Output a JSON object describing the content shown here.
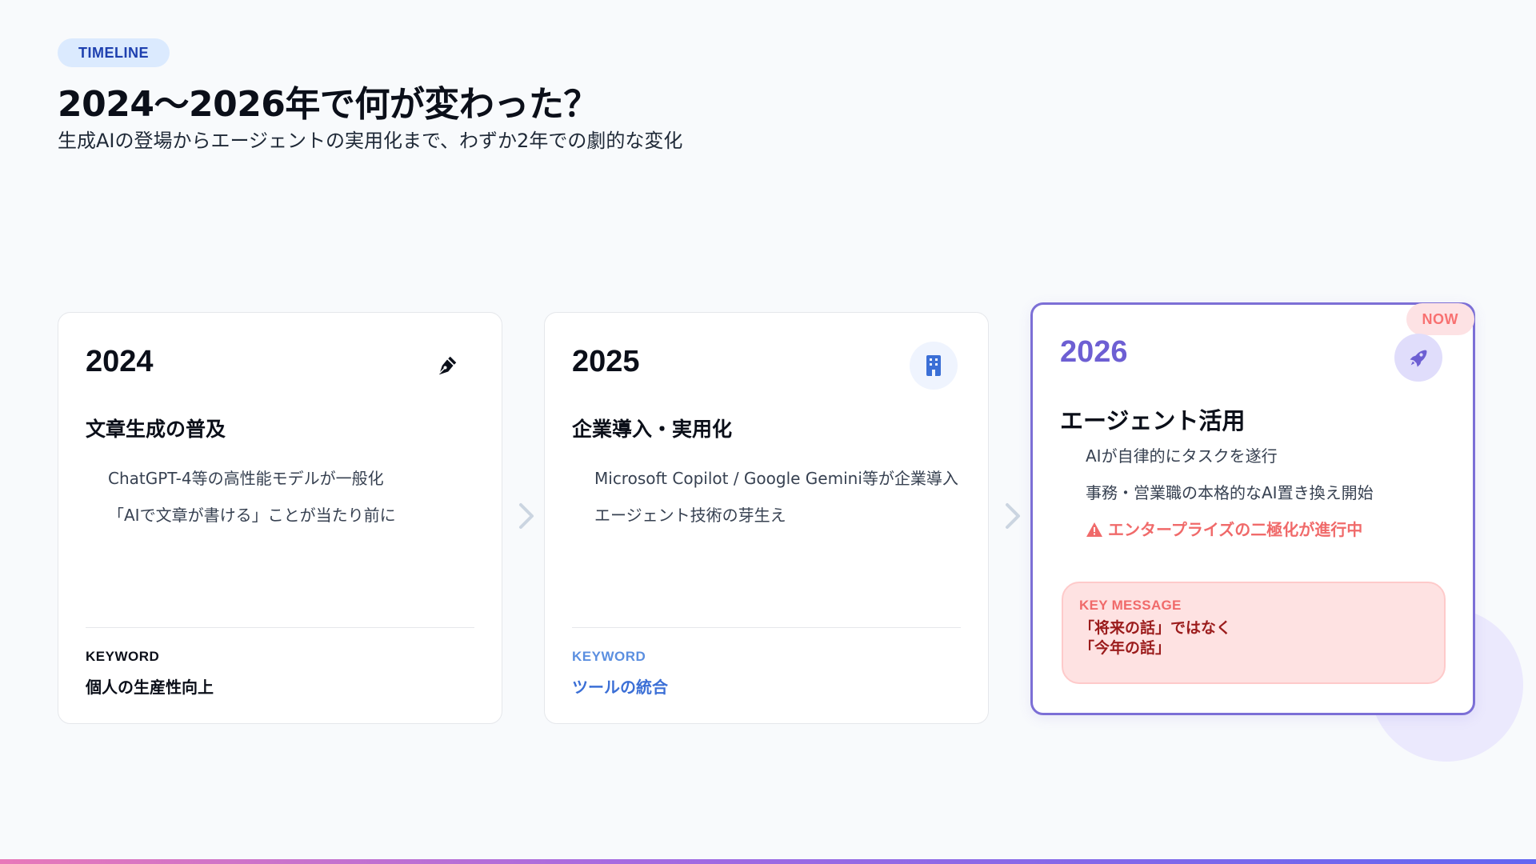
{
  "header": {
    "tag": "TIMELINE",
    "title": "2024〜2026年で何が変わった？",
    "subtitle": "生成AIの登場からエージェントの実用化まで、わずか2年での劇的な変化"
  },
  "cards": [
    {
      "year": "2024",
      "icon": "pen-nib-icon",
      "heading": "文章生成の普及",
      "bullets": [
        "ChatGPT-4等の高性能モデルが一般化",
        "「AIで文章が書ける」ことが当たり前に"
      ],
      "keyword_label": "KEYWORD",
      "keyword": "個人の生産性向上"
    },
    {
      "year": "2025",
      "icon": "building-icon",
      "heading": "企業導入・実用化",
      "bullets": [
        "Microsoft Copilot / Google Gemini等が企業導入",
        "エージェント技術の芽生え"
      ],
      "keyword_label": "KEYWORD",
      "keyword": "ツールの統合"
    },
    {
      "year": "2026",
      "icon": "rocket-icon",
      "badge": "NOW",
      "heading": "エージェント活用",
      "bullets": [
        "AIが自律的にタスクを遂行",
        "事務・営業職の本格的なAI置き換え開始"
      ],
      "alert": "エンタープライズの二極化が進行中",
      "key_label": "KEY MESSAGE",
      "key_message": "「将来の話」ではなく\n「今年の話」"
    }
  ],
  "colors": {
    "accent_purple": "#6d5fd3",
    "accent_blue": "#3b6fd6",
    "alert_red": "#f06a6a",
    "key_text": "#9b1c1c"
  }
}
